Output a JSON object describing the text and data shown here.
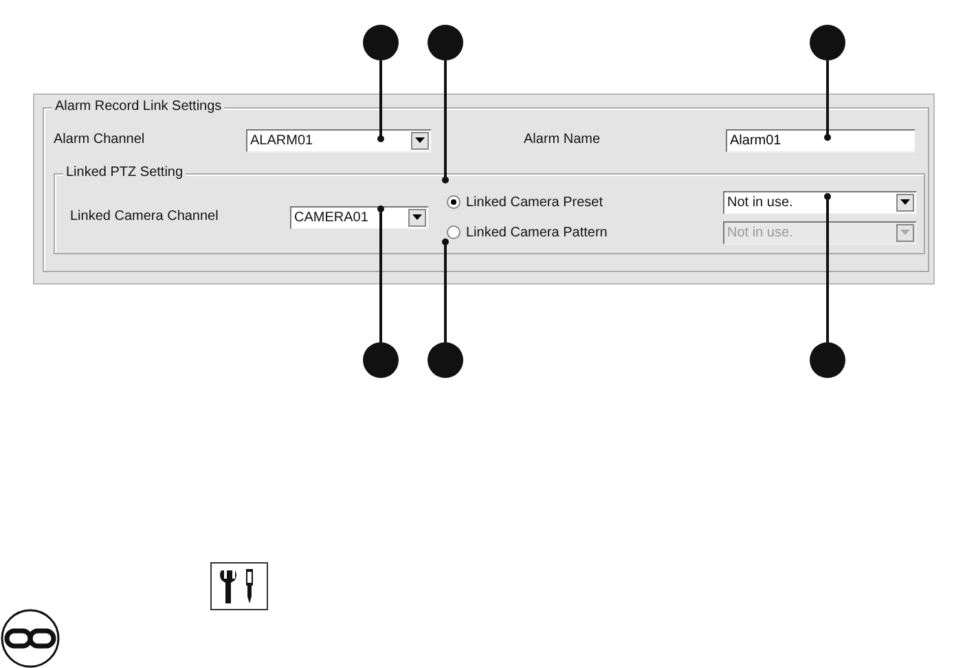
{
  "dialog": {
    "title": "Alarm Record Link Settings",
    "alarm_channel": {
      "label": "Alarm Channel",
      "value": "ALARM01"
    },
    "alarm_name": {
      "label": "Alarm Name",
      "value": "Alarm01"
    },
    "ptz": {
      "title": "Linked PTZ Setting",
      "camera_channel": {
        "label": "Linked Camera Channel",
        "value": "CAMERA01"
      },
      "options": [
        {
          "label": "Linked Camera Preset",
          "selected": true,
          "value": "Not in use.",
          "disabled": false
        },
        {
          "label": "Linked Camera Pattern",
          "selected": false,
          "value": "Not in use.",
          "disabled": true
        }
      ]
    }
  }
}
